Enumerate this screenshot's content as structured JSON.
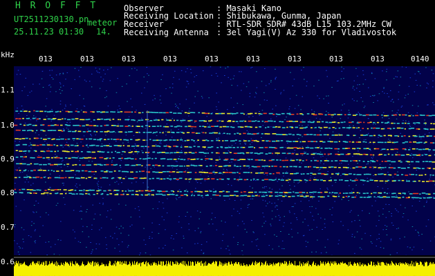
{
  "header": {
    "app_name": "H R O F F T",
    "file_name": "UT2511230130.pn",
    "mode": "meteor",
    "timestamp": "25.11.23 01:30",
    "value": "14.",
    "fields": [
      {
        "label": "Observer",
        "value": ": Masaki Kano"
      },
      {
        "label": "Receiving Location",
        "value": ": Shibukawa, Gunma, Japan"
      },
      {
        "label": "Receiver",
        "value": ": RTL-SDR SDR# 43dB L15 103.2MHz CW"
      },
      {
        "label": "Receiving Antenna",
        "value": ": 3el Yagi(V) Az 330 for Vladivostok"
      }
    ]
  },
  "y_axis": {
    "unit": "kHz",
    "ticks": [
      "1.1",
      "1.0",
      "0.9",
      "0.8",
      "0.7",
      "0.6"
    ]
  },
  "x_axis": {
    "ticks": [
      "013",
      "013",
      "013",
      "013",
      "013",
      "013",
      "013",
      "013",
      "013",
      "0140"
    ]
  },
  "colors": {
    "background": "#000000",
    "plot_background": "#02024a",
    "title_green": "#2fd34a",
    "spectrum_yellow": "#f5f000",
    "signal_cyan": "#29c4c8",
    "signal_yellow": "#e8e82a",
    "signal_red": "#e43a1f"
  }
}
